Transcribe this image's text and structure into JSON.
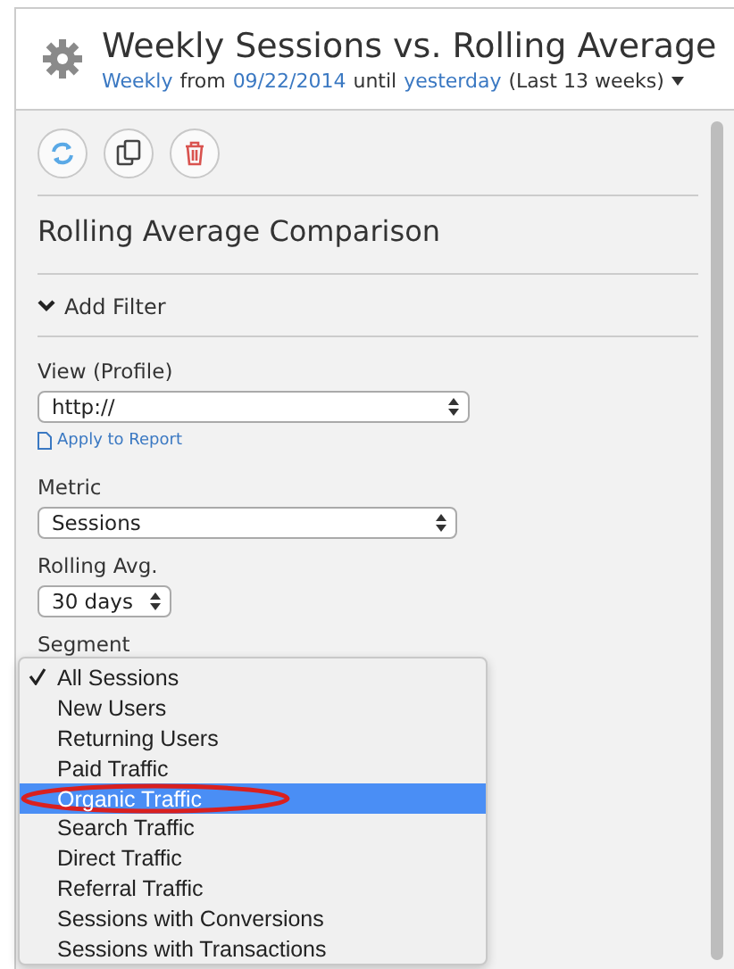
{
  "header": {
    "title": "Weekly Sessions vs. Rolling Average",
    "subtitle": [
      {
        "text": "Weekly",
        "kind": "link"
      },
      {
        "text": "from",
        "kind": "plain"
      },
      {
        "text": "09/22/2014",
        "kind": "link"
      },
      {
        "text": "until",
        "kind": "plain"
      },
      {
        "text": "yesterday",
        "kind": "link"
      },
      {
        "text": "(Last 13 weeks)",
        "kind": "plain"
      }
    ]
  },
  "toolbar": [
    {
      "kind": "refresh"
    },
    {
      "kind": "copy"
    },
    {
      "kind": "delete"
    }
  ],
  "section_title": "Rolling Average Comparison",
  "filter_toggle": {
    "label": "Add Filter",
    "expanded": true
  },
  "view": {
    "label": "View (Profile)",
    "value": "http://",
    "apply_link": "Apply to Report"
  },
  "metric": {
    "label": "Metric",
    "value": "Sessions"
  },
  "rolling_avg": {
    "label": "Rolling Avg.",
    "value": "30 days"
  },
  "segment": {
    "label": "Segment",
    "options": [
      {
        "label": "All Sessions",
        "checked": true,
        "selected": false
      },
      {
        "label": "New Users",
        "checked": false,
        "selected": false
      },
      {
        "label": "Returning Users",
        "checked": false,
        "selected": false
      },
      {
        "label": "Paid Traffic",
        "checked": false,
        "selected": false
      },
      {
        "label": "Organic Traffic",
        "checked": false,
        "selected": true
      },
      {
        "label": "Search Traffic",
        "checked": false,
        "selected": false
      },
      {
        "label": "Direct Traffic",
        "checked": false,
        "selected": false
      },
      {
        "label": "Referral Traffic",
        "checked": false,
        "selected": false
      },
      {
        "label": "Sessions with Conversions",
        "checked": false,
        "selected": false
      },
      {
        "label": "Sessions with Transactions",
        "checked": false,
        "selected": false
      }
    ]
  }
}
